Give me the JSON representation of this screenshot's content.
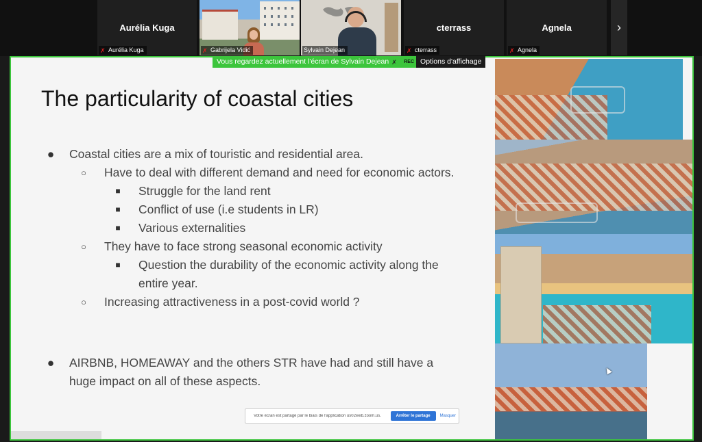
{
  "participants": [
    {
      "big_name": "Aurélia Kuga",
      "tag": "Aurélia Kuga",
      "video": false
    },
    {
      "big_name": "",
      "tag": "Gabrijela Vidić",
      "video": true
    },
    {
      "big_name": "",
      "tag": "Sylvain Dejean",
      "video": true,
      "active": true
    },
    {
      "big_name": "cterrass",
      "tag": "cterrass",
      "video": false
    },
    {
      "big_name": "Agnela",
      "tag": "Agnela",
      "video": false
    }
  ],
  "strip": {
    "next_icon": "›"
  },
  "banner": {
    "message": "Vous regardez actuellement l'écran de Sylvain Dejean",
    "rec": "REC",
    "options": "Options d'affichage"
  },
  "slide": {
    "title": "The particularity of coastal cities",
    "bullets": [
      {
        "level": 1,
        "marker": "●",
        "text": "Coastal cities are a mix of touristic and residential area."
      },
      {
        "level": 2,
        "marker": "○",
        "text": "Have to deal with different demand and need for economic actors."
      },
      {
        "level": 3,
        "marker": "■",
        "text": "Struggle for the land rent"
      },
      {
        "level": 3,
        "marker": "■",
        "text": "Conflict of use (i.e students in LR)"
      },
      {
        "level": 3,
        "marker": "■",
        "text": "Various externalities"
      },
      {
        "level": 2,
        "marker": "○",
        "text": "They have to face strong seasonal economic activity"
      },
      {
        "level": 3,
        "marker": "■",
        "text": "Question the durability of the economic activity along the entire year."
      },
      {
        "level": 2,
        "marker": "○",
        "text": "Increasing attractiveness in a post-covid world ?"
      },
      {
        "level": 1,
        "marker": "●",
        "text": "AIRBNB, HOMEAWAY and the others STR have had and still have a huge impact on all of these aspects.",
        "gap_before": true
      }
    ]
  },
  "share_toast": {
    "text": "Votre écran est partagé par le biais de l'application us02web.zoom.us.",
    "stop": "Arrêter le partage",
    "hide": "Masquer"
  },
  "colors": {
    "accent": "#3cc53c",
    "mic_off": "#e02020",
    "button_blue": "#2f74d6"
  }
}
